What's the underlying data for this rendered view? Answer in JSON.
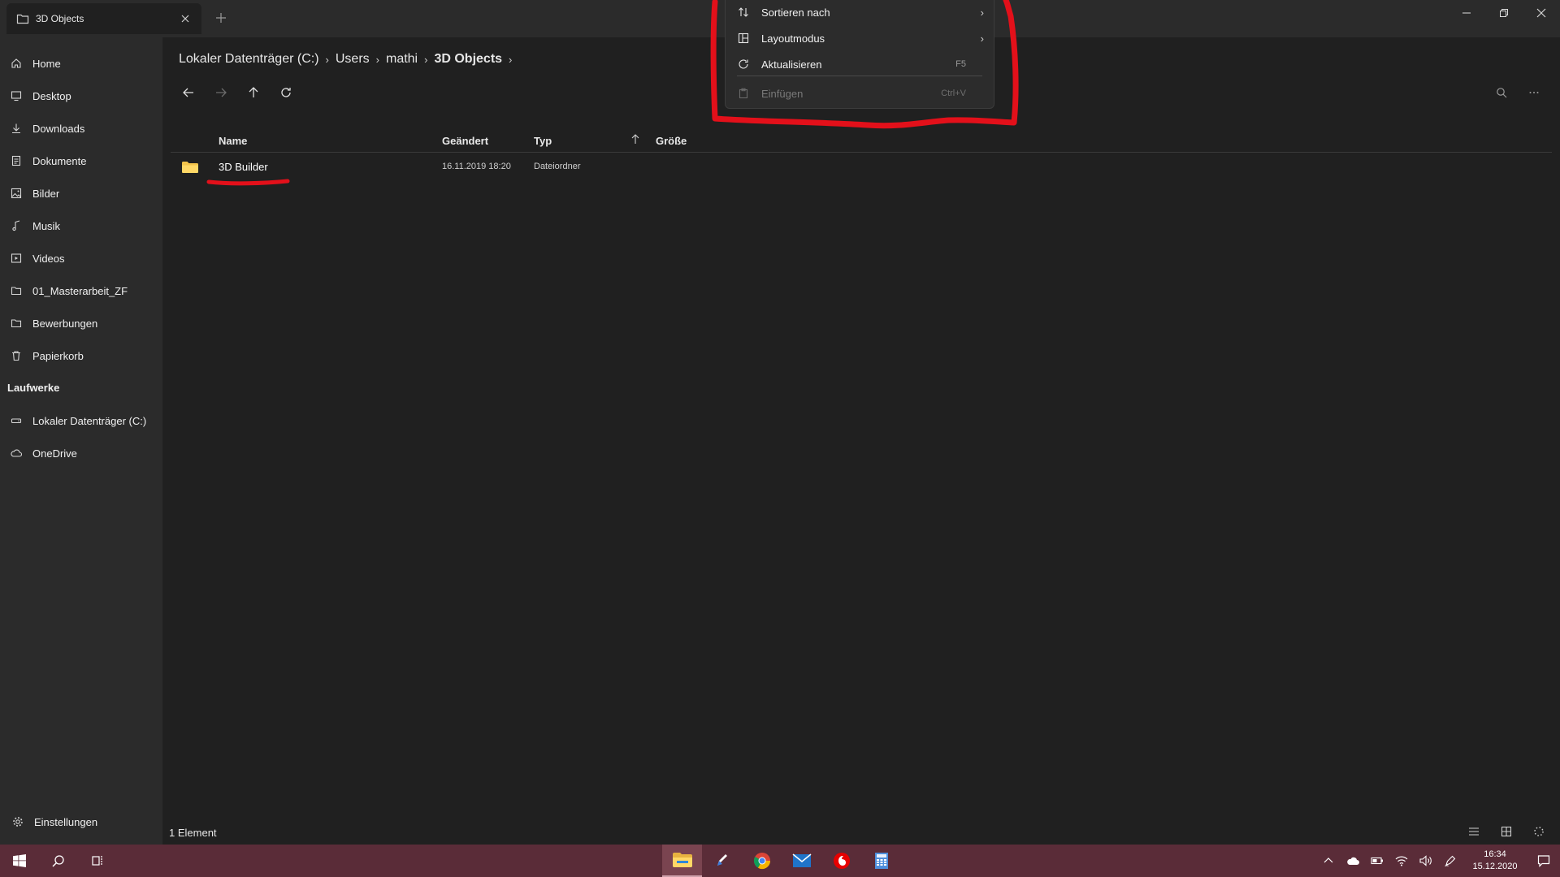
{
  "window": {
    "tab_title": "3D Objects"
  },
  "sidebar": {
    "items": [
      {
        "label": "Home",
        "icon": "home-icon"
      },
      {
        "label": "Desktop",
        "icon": "desktop-icon"
      },
      {
        "label": "Downloads",
        "icon": "download-icon"
      },
      {
        "label": "Dokumente",
        "icon": "document-icon"
      },
      {
        "label": "Bilder",
        "icon": "picture-icon"
      },
      {
        "label": "Musik",
        "icon": "music-icon"
      },
      {
        "label": "Videos",
        "icon": "video-icon"
      },
      {
        "label": "01_Masterarbeit_ZF",
        "icon": "folder-icon"
      },
      {
        "label": "Bewerbungen",
        "icon": "folder-icon"
      },
      {
        "label": "Papierkorb",
        "icon": "recycle-bin-icon"
      }
    ],
    "drives_heading": "Laufwerke",
    "drives": [
      {
        "label": "Lokaler Datenträger (C:)",
        "icon": "drive-icon"
      },
      {
        "label": "OneDrive",
        "icon": "cloud-icon"
      }
    ],
    "settings_label": "Einstellungen"
  },
  "breadcrumb": {
    "items": [
      "Lokaler Datenträger (C:)",
      "Users",
      "mathi",
      "3D Objects"
    ]
  },
  "columns": {
    "name": "Name",
    "modified": "Geändert",
    "type": "Typ",
    "size": "Größe"
  },
  "files": [
    {
      "name": "3D Builder",
      "modified": "16.11.2019 18:20",
      "type": "Dateiordner",
      "size": ""
    }
  ],
  "status": {
    "count": "1 Element"
  },
  "context_menu": {
    "items": [
      {
        "label": "Sortieren nach",
        "shortcut": "",
        "submenu": true
      },
      {
        "label": "Layoutmodus",
        "shortcut": "",
        "submenu": true
      },
      {
        "label": "Aktualisieren",
        "shortcut": "F5",
        "submenu": false
      },
      {
        "label": "Einfügen",
        "shortcut": "Ctrl+V",
        "submenu": false,
        "disabled": true
      }
    ]
  },
  "taskbar": {
    "time": "16:34",
    "date": "15.12.2020"
  },
  "colors": {
    "annotation": "#e3101a",
    "taskbar": "#5a2c38"
  }
}
